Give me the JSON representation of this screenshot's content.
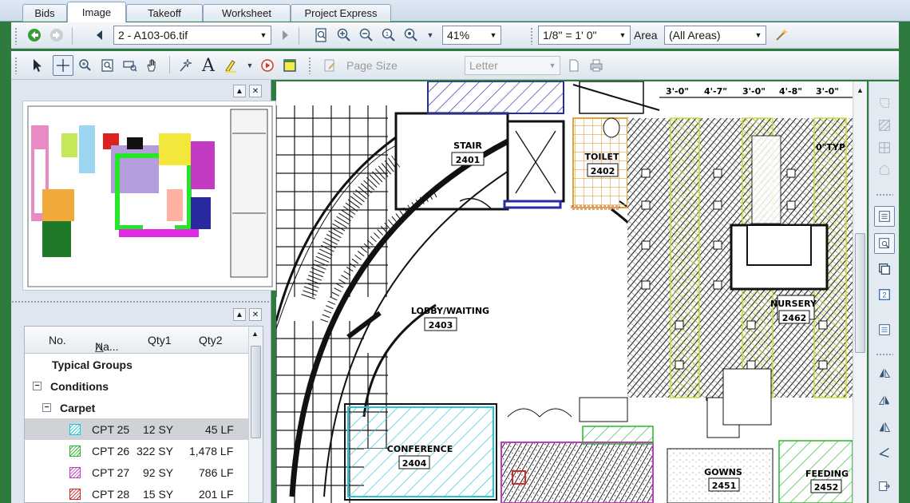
{
  "tabs": [
    {
      "label": "Bids",
      "active": false
    },
    {
      "label": "Image",
      "active": true
    },
    {
      "label": "Takeoff",
      "active": false
    },
    {
      "label": "Worksheet",
      "active": false
    },
    {
      "label": "Project Express",
      "active": false
    }
  ],
  "toolbar": {
    "page_select": "2 - A103-06.tif",
    "zoom_value": "41%",
    "scale_value": "1/8\" = 1' 0\"",
    "area_label": "Area",
    "area_value": "(All Areas)",
    "page_size_label": "Page Size",
    "page_size_value": "Letter"
  },
  "conditions_grid": {
    "columns": [
      "No.",
      "Na...",
      "Qty1",
      "Qty2"
    ],
    "sort_indicator": "△",
    "groups": {
      "typical_groups": "Typical Groups",
      "conditions": "Conditions",
      "carpet": "Carpet"
    },
    "rows": [
      {
        "name": "CPT 25",
        "qty1": "12 SY",
        "qty2": "45 LF",
        "color": "#22c3d6",
        "selected": true
      },
      {
        "name": "CPT 26",
        "qty1": "322 SY",
        "qty2": "1,478 LF",
        "color": "#29b52c",
        "selected": false
      },
      {
        "name": "CPT 27",
        "qty1": "92 SY",
        "qty2": "786 LF",
        "color": "#c23bc2",
        "selected": false
      },
      {
        "name": "CPT 28",
        "qty1": "15 SY",
        "qty2": "201 LF",
        "color": "#d12a2a",
        "selected": false
      }
    ],
    "expanders": {
      "collapse": "−"
    }
  },
  "drawing": {
    "rooms": [
      {
        "name": "STAIR",
        "number": "2401"
      },
      {
        "name": "TOILET",
        "number": "2402"
      },
      {
        "name": "LOBBY/WAITING",
        "number": "2403"
      },
      {
        "name": "CONFERENCE",
        "number": "2404"
      },
      {
        "name": "NURSERY",
        "number": "2462"
      },
      {
        "name": "GOWNS",
        "number": "2451"
      },
      {
        "name": "FEEDING",
        "number": "2452"
      }
    ],
    "dimensions": [
      "3'-0\"",
      "4'-7\"",
      "3'-0\"",
      "4'-8\"",
      "3'-0\""
    ],
    "notes": [
      "0\"TYP"
    ]
  },
  "colors": {
    "cyan_hatch": "#22c3d6",
    "green_hatch": "#29b52c",
    "yellow_hatch": "#d8e84a",
    "magenta_hatch": "#c23bc2",
    "blue_hatch": "#2a2aa0",
    "orange_hatch": "#e2a43a"
  }
}
